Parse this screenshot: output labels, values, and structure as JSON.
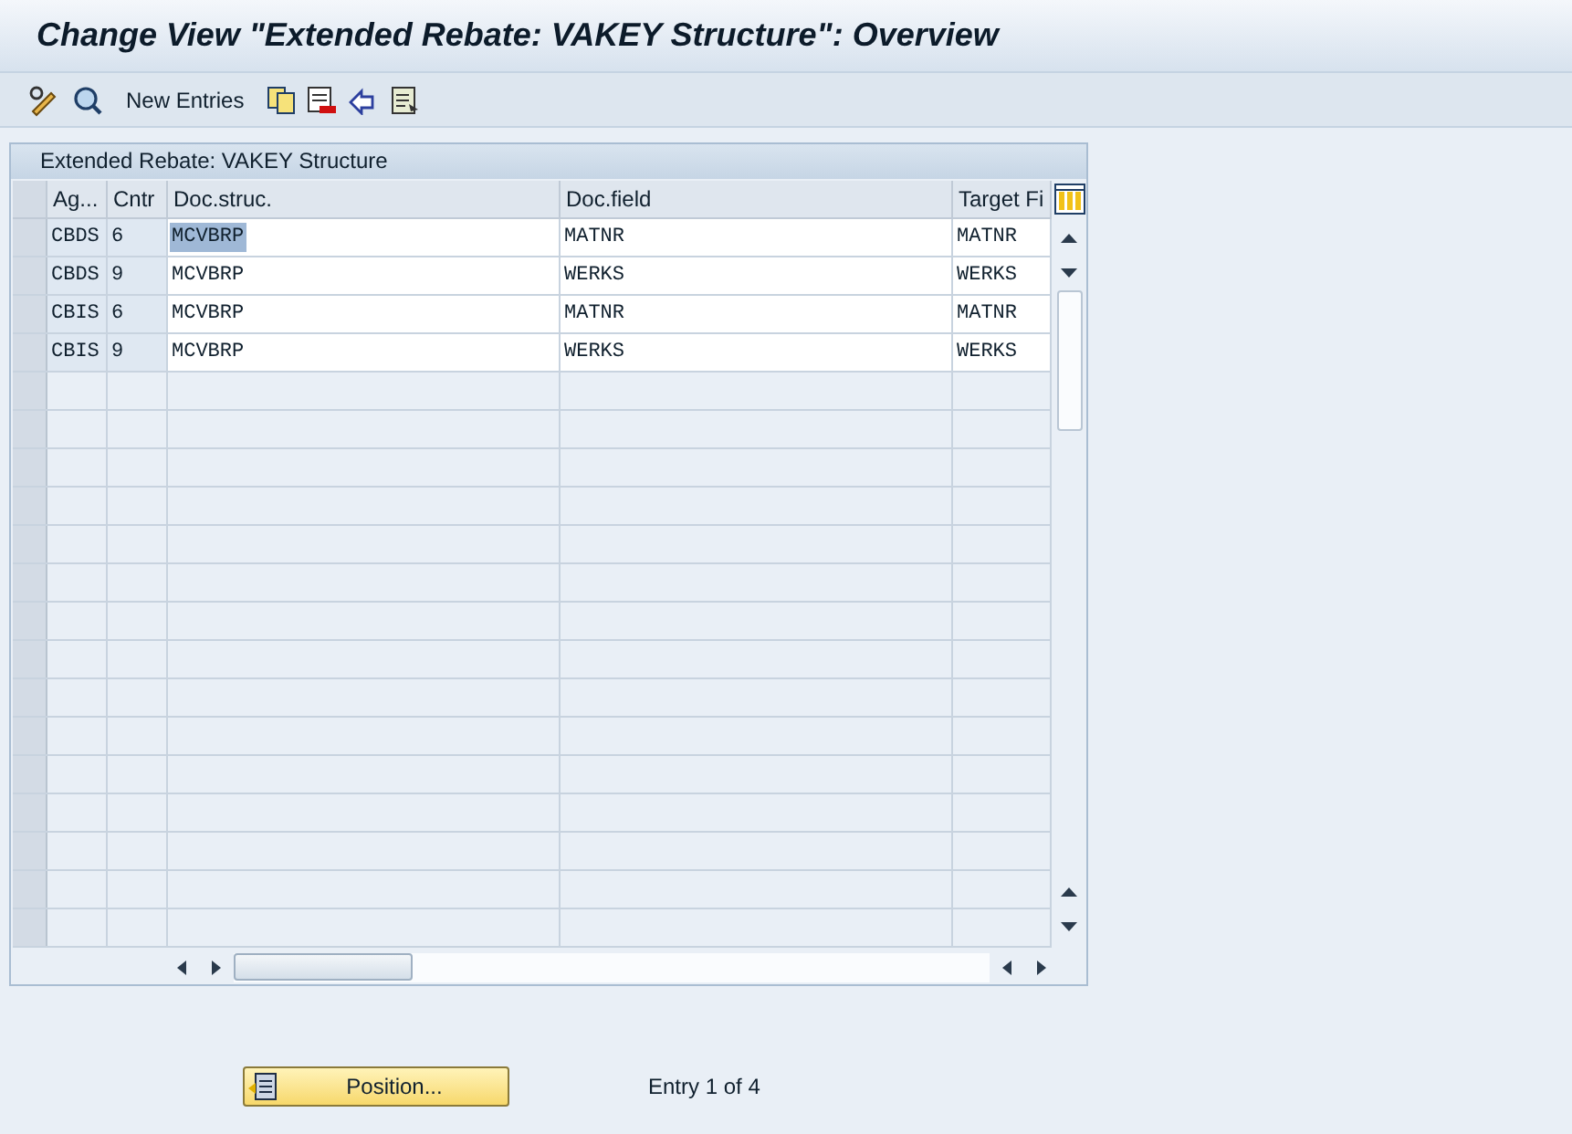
{
  "window": {
    "title": "Change View \"Extended Rebate: VAKEY Structure\": Overview"
  },
  "toolbar": {
    "new_entries": "New Entries"
  },
  "table": {
    "title": "Extended Rebate: VAKEY Structure",
    "columns": [
      "Ag...",
      "Cntr",
      "Doc.struc.",
      "Doc.field",
      "Target Fi"
    ],
    "rows": [
      {
        "cells": [
          {
            "text": "CBDS",
            "selected": false
          },
          {
            "text": "6",
            "selected": false
          },
          {
            "text": "MCVBRP",
            "selected": true
          },
          {
            "text": "MATNR",
            "selected": false
          },
          {
            "text": "MATNR",
            "selected": false
          }
        ]
      },
      {
        "cells": [
          {
            "text": "CBDS",
            "selected": false
          },
          {
            "text": "9",
            "selected": false
          },
          {
            "text": "MCVBRP",
            "selected": false
          },
          {
            "text": "WERKS",
            "selected": false
          },
          {
            "text": "WERKS",
            "selected": false
          }
        ]
      },
      {
        "cells": [
          {
            "text": "CBIS",
            "selected": false
          },
          {
            "text": "6",
            "selected": false
          },
          {
            "text": "MCVBRP",
            "selected": false
          },
          {
            "text": "MATNR",
            "selected": false
          },
          {
            "text": "MATNR",
            "selected": false
          }
        ]
      },
      {
        "cells": [
          {
            "text": "CBIS",
            "selected": false
          },
          {
            "text": "9",
            "selected": false
          },
          {
            "text": "MCVBRP",
            "selected": false
          },
          {
            "text": "WERKS",
            "selected": false
          },
          {
            "text": "WERKS",
            "selected": false
          }
        ]
      }
    ]
  },
  "footer": {
    "position_button": "Position...",
    "entry_info": "Entry 1 of 4"
  }
}
